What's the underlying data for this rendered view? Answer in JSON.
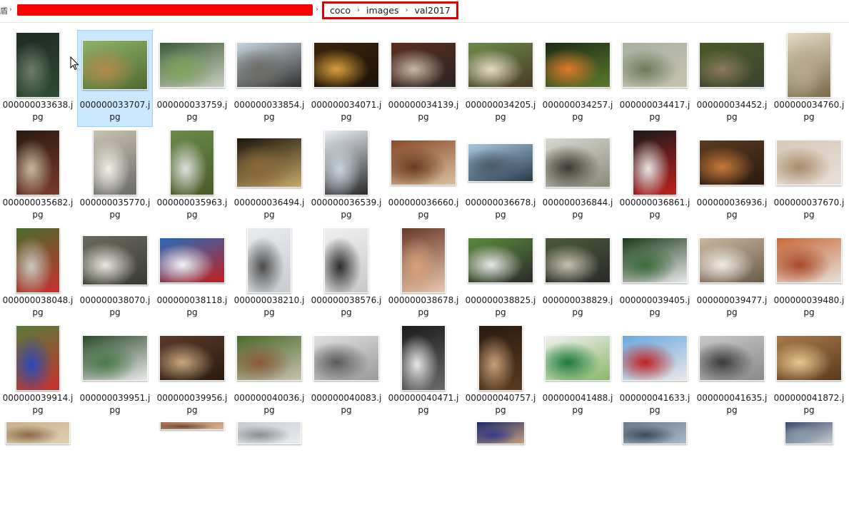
{
  "address": {
    "lead_char": "盾",
    "crumbs": [
      "coco",
      "images",
      "val2017"
    ]
  },
  "files": [
    {
      "name": "000000033638.jpg",
      "shape": "portrait",
      "colors": [
        "#1e2a22",
        "#6b7f6a",
        "#2d4a33"
      ]
    },
    {
      "name": "000000033707.jpg",
      "shape": "land43",
      "colors": [
        "#8fb26a",
        "#b5894d",
        "#4d6b2f"
      ]
    },
    {
      "name": "000000033759.jpg",
      "shape": "land32",
      "colors": [
        "#3d5b3a",
        "#7da45a",
        "#c9cfc0"
      ]
    },
    {
      "name": "000000033854.jpg",
      "shape": "land32",
      "colors": [
        "#c8d4dd",
        "#6d6c66",
        "#2f2f2f"
      ]
    },
    {
      "name": "000000034071.jpg",
      "shape": "land32",
      "colors": [
        "#3a230c",
        "#d9a03b",
        "#1d120a"
      ]
    },
    {
      "name": "000000034139.jpg",
      "shape": "land32",
      "colors": [
        "#5b2d21",
        "#c8b8a4",
        "#2a2424"
      ]
    },
    {
      "name": "000000034205.jpg",
      "shape": "land32",
      "colors": [
        "#6b8a4a",
        "#e6dcc3",
        "#4a3a28"
      ]
    },
    {
      "name": "000000034257.jpg",
      "shape": "land32",
      "colors": [
        "#1d2a15",
        "#e07a2a",
        "#587a2e"
      ]
    },
    {
      "name": "000000034417.jpg",
      "shape": "land32",
      "colors": [
        "#a8b2a2",
        "#6d7a5a",
        "#c8c2b0"
      ]
    },
    {
      "name": "000000034452.jpg",
      "shape": "land32",
      "colors": [
        "#4a5a2a",
        "#8a7a5a",
        "#3a4230"
      ]
    },
    {
      "name": "000000034760.jpg",
      "shape": "portrait",
      "colors": [
        "#e4dcc6",
        "#b8a98a",
        "#7a6a4a"
      ]
    },
    {
      "name": "000000035682.jpg",
      "shape": "portrait",
      "colors": [
        "#2a1a12",
        "#c8b8a0",
        "#7a3a2a"
      ]
    },
    {
      "name": "000000035770.jpg",
      "shape": "portrait",
      "colors": [
        "#c8c2b0",
        "#f2efe8",
        "#6a6a6a"
      ]
    },
    {
      "name": "000000035963.jpg",
      "shape": "portrait",
      "colors": [
        "#6a8a4a",
        "#e0e0e0",
        "#4a5a2a"
      ]
    },
    {
      "name": "000000036494.jpg",
      "shape": "land43",
      "colors": [
        "#1a140c",
        "#8a6a3a",
        "#c8a86a"
      ]
    },
    {
      "name": "000000036539.jpg",
      "shape": "portrait",
      "colors": [
        "#e8eef4",
        "#c8d2dc",
        "#2a2a2a"
      ]
    },
    {
      "name": "000000036660.jpg",
      "shape": "land32",
      "colors": [
        "#8a4a2a",
        "#6a3a20",
        "#d8c0a0"
      ]
    },
    {
      "name": "000000036678.jpg",
      "shape": "wide",
      "colors": [
        "#a8c8e0",
        "#4a5a6a",
        "#2a3a4a"
      ]
    },
    {
      "name": "000000036844.jpg",
      "shape": "land43",
      "colors": [
        "#d8d8d0",
        "#3a3a32",
        "#8a8a7a"
      ]
    },
    {
      "name": "000000036861.jpg",
      "shape": "portrait",
      "colors": [
        "#1a1a1a",
        "#e8e8e8",
        "#c02020"
      ]
    },
    {
      "name": "000000036936.jpg",
      "shape": "land32",
      "colors": [
        "#5a3a20",
        "#c87a3a",
        "#2a1a10"
      ]
    },
    {
      "name": "000000037670.jpg",
      "shape": "land32",
      "colors": [
        "#d8c8b8",
        "#a88a6a",
        "#e8e0d8"
      ]
    },
    {
      "name": "000000038048.jpg",
      "shape": "portrait",
      "colors": [
        "#4a6a2a",
        "#c8c8c0",
        "#c83030"
      ]
    },
    {
      "name": "000000038070.jpg",
      "shape": "land43",
      "colors": [
        "#6a6a60",
        "#e8e8e0",
        "#3a3a34"
      ]
    },
    {
      "name": "000000038118.jpg",
      "shape": "land32",
      "colors": [
        "#2a6ab8",
        "#f0f4f8",
        "#c02020"
      ]
    },
    {
      "name": "000000038210.jpg",
      "shape": "portrait",
      "colors": [
        "#e8ecef",
        "#4a4a4a",
        "#c8ccd0"
      ]
    },
    {
      "name": "000000038576.jpg",
      "shape": "portrait",
      "colors": [
        "#f0f0f0",
        "#2a2a2a",
        "#c8c8c8"
      ]
    },
    {
      "name": "000000038678.jpg",
      "shape": "portrait",
      "colors": [
        "#6a3a2a",
        "#d8a07a",
        "#e8c8b0"
      ]
    },
    {
      "name": "000000038825.jpg",
      "shape": "land32",
      "colors": [
        "#5a8a3a",
        "#e8e8e8",
        "#2a2a2a"
      ]
    },
    {
      "name": "000000038829.jpg",
      "shape": "land32",
      "colors": [
        "#4a5a3a",
        "#c8c0b0",
        "#2a2a2a"
      ]
    },
    {
      "name": "000000039405.jpg",
      "shape": "land32",
      "colors": [
        "#1a3a1a",
        "#3a6a3a",
        "#e8e8e8"
      ]
    },
    {
      "name": "000000039477.jpg",
      "shape": "land32",
      "colors": [
        "#c8b8a0",
        "#f0ece4",
        "#6a5a4a"
      ]
    },
    {
      "name": "000000039480.jpg",
      "shape": "land32",
      "colors": [
        "#c86a3a",
        "#a84a2a",
        "#e8e0d8"
      ]
    },
    {
      "name": "000000039914.jpg",
      "shape": "portrait",
      "colors": [
        "#5a7a3a",
        "#2a4ab8",
        "#c83030"
      ]
    },
    {
      "name": "000000039951.jpg",
      "shape": "land32",
      "colors": [
        "#2a4a2a",
        "#4a7a4a",
        "#e8e8e8"
      ]
    },
    {
      "name": "000000039956.jpg",
      "shape": "land32",
      "colors": [
        "#5a3a2a",
        "#c8a880",
        "#2a1a10"
      ]
    },
    {
      "name": "000000040036.jpg",
      "shape": "land32",
      "colors": [
        "#4a6a2a",
        "#8a5a3a",
        "#c8c0b0"
      ]
    },
    {
      "name": "000000040083.jpg",
      "shape": "land32",
      "colors": [
        "#e0e0e0",
        "#5a5a5a",
        "#9a9a9a"
      ]
    },
    {
      "name": "000000040471.jpg",
      "shape": "portrait",
      "colors": [
        "#1a1a1a",
        "#e8e8e8",
        "#6a6a6a"
      ]
    },
    {
      "name": "000000040757.jpg",
      "shape": "portrait",
      "colors": [
        "#2a1a10",
        "#c8a07a",
        "#5a3a20"
      ]
    },
    {
      "name": "000000041488.jpg",
      "shape": "land32",
      "colors": [
        "#f0f0f0",
        "#1a7a3a",
        "#8ab86a"
      ]
    },
    {
      "name": "000000041633.jpg",
      "shape": "land32",
      "colors": [
        "#6aa8e0",
        "#c02020",
        "#e8e8e8"
      ]
    },
    {
      "name": "000000041635.jpg",
      "shape": "land32",
      "colors": [
        "#c8c8c8",
        "#3a3a3a",
        "#8a8a8a"
      ]
    },
    {
      "name": "000000041872.jpg",
      "shape": "land32",
      "colors": [
        "#a87a4a",
        "#e8c890",
        "#5a3a20"
      ]
    },
    {
      "name": "",
      "shape": "partial",
      "colors": [
        "#c8b090",
        "#8a6a4a",
        "#e0d0b0"
      ]
    },
    {
      "name": "",
      "shape": "none",
      "colors": [
        "#ffffff",
        "#ffffff",
        "#ffffff"
      ]
    },
    {
      "name": "",
      "shape": "partialThin",
      "colors": [
        "#a86a4a",
        "#6a4a3a",
        "#d8b090"
      ]
    },
    {
      "name": "",
      "shape": "partial",
      "colors": [
        "#c8ccd0",
        "#8a8e92",
        "#e8ecf0"
      ]
    },
    {
      "name": "",
      "shape": "none",
      "colors": [
        "#ffffff",
        "#ffffff",
        "#ffffff"
      ]
    },
    {
      "name": "",
      "shape": "none",
      "colors": [
        "#ffffff",
        "#ffffff",
        "#ffffff"
      ]
    },
    {
      "name": "",
      "shape": "partialSmall",
      "colors": [
        "#1a2a6a",
        "#3a3a8a",
        "#c8a07a"
      ]
    },
    {
      "name": "",
      "shape": "none",
      "colors": [
        "#ffffff",
        "#ffffff",
        "#ffffff"
      ]
    },
    {
      "name": "",
      "shape": "partial",
      "colors": [
        "#6a7a8a",
        "#3a4a5a",
        "#a8b8c8"
      ]
    },
    {
      "name": "",
      "shape": "none",
      "colors": [
        "#ffffff",
        "#ffffff",
        "#ffffff"
      ]
    },
    {
      "name": "",
      "shape": "partialSmall",
      "colors": [
        "#3a4a6a",
        "#8a9aaa",
        "#c8d0d8"
      ]
    }
  ],
  "selected_index": 1
}
